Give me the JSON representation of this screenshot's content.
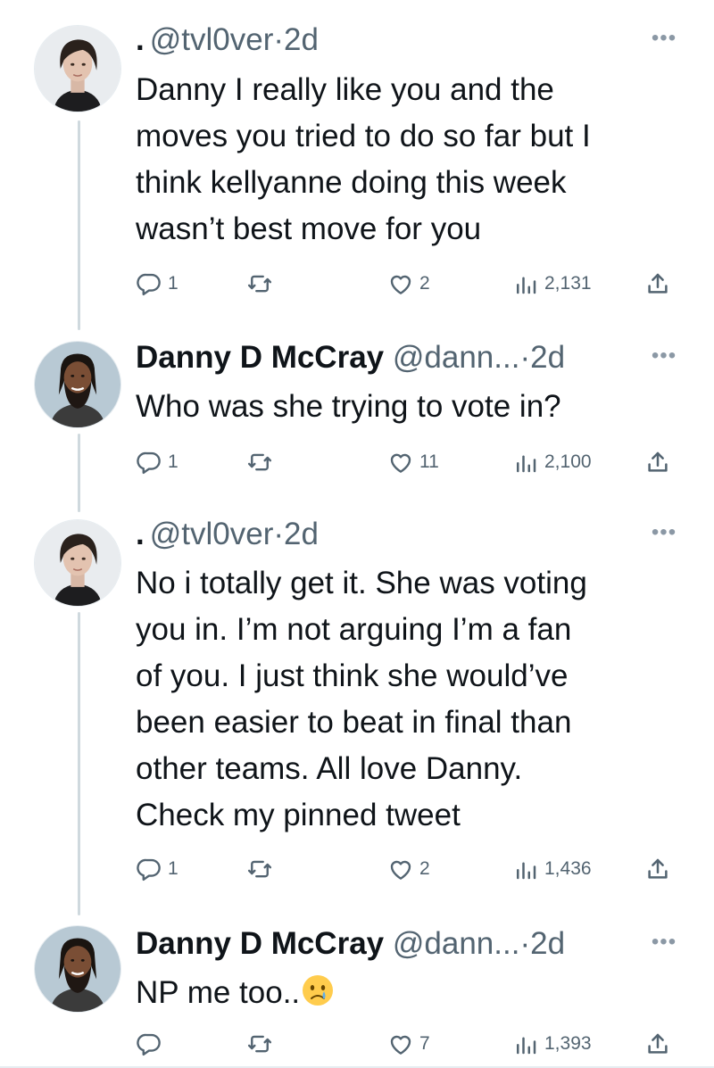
{
  "colors": {
    "text": "#0f1419",
    "muted": "#536471",
    "thread_line": "#cfd9de"
  },
  "icons": {
    "reply": "reply-icon",
    "retweet": "retweet-icon",
    "like": "heart-icon",
    "views": "bar-chart-icon",
    "share": "share-icon",
    "more": "more-icon"
  },
  "tweets": [
    {
      "prefix": ".",
      "name": "",
      "handle": "@tvl0ver",
      "sep": "·",
      "time": "2d",
      "text": "Danny I really like you and the\nmoves you tried to do so far but I\nthink kellyanne doing this week\nwasn’t best move for you",
      "replies": "1",
      "retweets": "",
      "likes": "2",
      "views": "2,131"
    },
    {
      "prefix": "",
      "name": "Danny D McCray",
      "handle": "@dann...",
      "sep": "·",
      "time": "2d",
      "text": "Who was she trying to vote in?",
      "replies": "1",
      "retweets": "",
      "likes": "11",
      "views": "2,100"
    },
    {
      "prefix": ".",
      "name": "",
      "handle": "@tvl0ver",
      "sep": "·",
      "time": "2d",
      "text": "No i totally get it. She was voting\nyou in. I’m not arguing I’m a fan\nof you. I just think she would’ve\nbeen easier to beat in final than\nother teams. All love Danny.\nCheck my pinned tweet",
      "replies": "1",
      "retweets": "",
      "likes": "2",
      "views": "1,436"
    },
    {
      "prefix": "",
      "name": "Danny D McCray",
      "handle": "@dann...",
      "sep": "·",
      "time": "2d",
      "text": "NP me too..",
      "emoji": "crying-face",
      "replies": "",
      "retweets": "",
      "likes": "7",
      "views": "1,393"
    }
  ]
}
